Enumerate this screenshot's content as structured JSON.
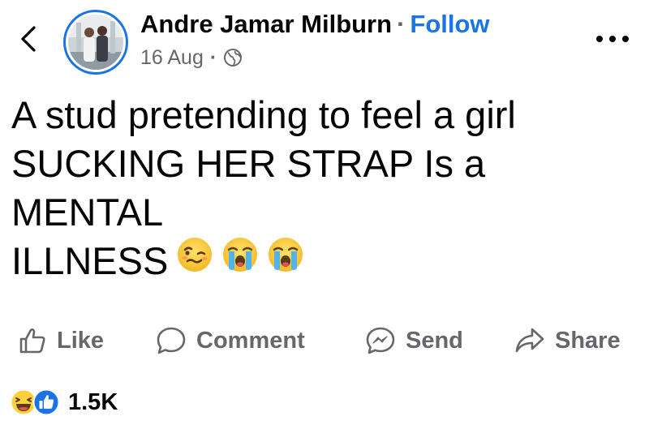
{
  "post": {
    "author": "Andre Jamar Milburn",
    "separator": "·",
    "follow_label": "Follow",
    "date": "16 Aug",
    "meta_separator": "·",
    "visibility_icon": "globe-icon",
    "text_lines": [
      "A stud pretending to feel a girl",
      "SUCKING HER STRAP Is a",
      "MENTAL",
      "ILLNESS"
    ],
    "emojis": [
      "woozy-face-emoji",
      "loudly-crying-face-emoji",
      "loudly-crying-face-emoji"
    ]
  },
  "actions": {
    "like_label": "Like",
    "comment_label": "Comment",
    "send_label": "Send",
    "share_label": "Share"
  },
  "reactions": {
    "icons": [
      "haha-reaction-icon",
      "like-reaction-icon"
    ],
    "count": "1.5K"
  },
  "colors": {
    "accent": "#1b74e4",
    "text": "#050505",
    "secondary": "#65676b"
  }
}
